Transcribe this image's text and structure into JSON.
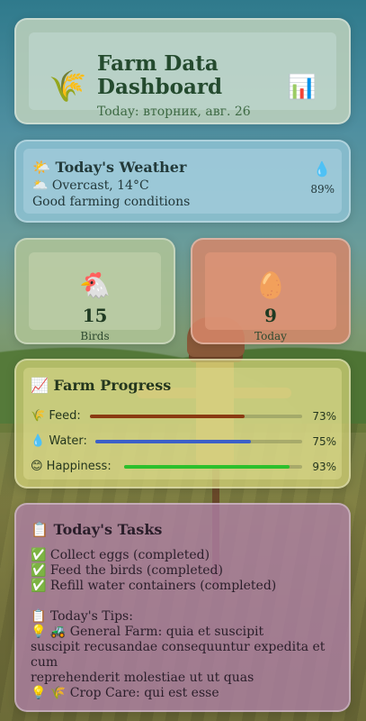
{
  "header": {
    "icon": "🌾",
    "title": "Farm Data Dashboard",
    "date": "Today: вторник, авг. 26",
    "chart_icon": "📊"
  },
  "weather": {
    "title": "🌤️ Today's Weather",
    "condition": "🌥️ Overcast, 14°C",
    "note": "Good farming conditions",
    "humidity_icon": "💧",
    "humidity": "89%"
  },
  "stats": {
    "birds": {
      "emoji": "🐔",
      "value": "15",
      "label": "Birds"
    },
    "eggs": {
      "emoji": "🥚",
      "value": "9",
      "label": "Today"
    }
  },
  "progress": {
    "title": "📈 Farm Progress",
    "rows": [
      {
        "label": "🌾 Feed:",
        "value": "73%",
        "fraction": 0.73,
        "color": "#8a3a12"
      },
      {
        "label": "💧 Water:",
        "value": "75%",
        "fraction": 0.75,
        "color": "#3c60c8"
      },
      {
        "label": "😊 Happiness:",
        "value": "93%",
        "fraction": 0.93,
        "color": "#2cc02c"
      }
    ]
  },
  "tasks": {
    "title": "📋 Today's Tasks",
    "items": [
      "✅ Collect eggs (completed)",
      "✅ Feed the birds (completed)",
      "✅ Refill water containers (completed)"
    ],
    "tips_title": "📋 Today's Tips:",
    "tip1_line1": "💡 🚜 General Farm: quia et suscipit",
    "tip1_line2": "suscipit recusandae consequuntur expedita et cum",
    "tip1_line3": "reprehenderit molestiae ut ut quas",
    "tip2": "💡 🌾 Crop Care: qui est esse"
  }
}
